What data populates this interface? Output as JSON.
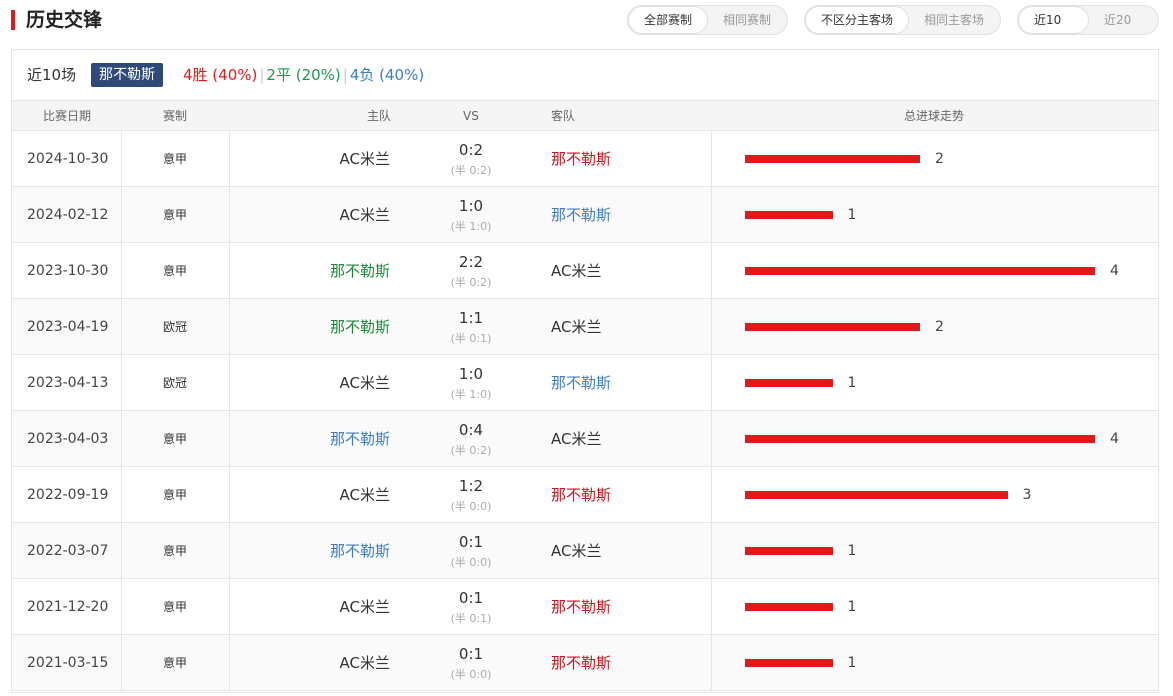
{
  "header": {
    "title": "历史交锋",
    "filters": [
      {
        "options": [
          "全部赛制",
          "相同赛制"
        ],
        "active": 0
      },
      {
        "options": [
          "不区分主客场",
          "相同主客场"
        ],
        "active": 0
      },
      {
        "options": [
          "近10场",
          "近20场"
        ],
        "active": 0
      }
    ]
  },
  "summary": {
    "label": "近10场",
    "team": "那不勒斯",
    "wins": "4胜 (40%)",
    "draws": "2平 (20%)",
    "losses": "4负 (40%)"
  },
  "table": {
    "columns": [
      "比赛日期",
      "赛制",
      "主队",
      "VS",
      "客队",
      "总进球走势"
    ],
    "rows": [
      {
        "date": "2024-10-30",
        "comp": "意甲",
        "home": "AC米兰",
        "home_color": "dark",
        "score": "0:2",
        "half": "(半 0:2)",
        "away": "那不勒斯",
        "away_color": "red",
        "total": 2
      },
      {
        "date": "2024-02-12",
        "comp": "意甲",
        "home": "AC米兰",
        "home_color": "dark",
        "score": "1:0",
        "half": "(半 1:0)",
        "away": "那不勒斯",
        "away_color": "blue",
        "total": 1
      },
      {
        "date": "2023-10-30",
        "comp": "意甲",
        "home": "那不勒斯",
        "home_color": "green",
        "score": "2:2",
        "half": "(半 0:2)",
        "away": "AC米兰",
        "away_color": "dark",
        "total": 4
      },
      {
        "date": "2023-04-19",
        "comp": "欧冠",
        "home": "那不勒斯",
        "home_color": "green",
        "score": "1:1",
        "half": "(半 0:1)",
        "away": "AC米兰",
        "away_color": "dark",
        "total": 2
      },
      {
        "date": "2023-04-13",
        "comp": "欧冠",
        "home": "AC米兰",
        "home_color": "dark",
        "score": "1:0",
        "half": "(半 1:0)",
        "away": "那不勒斯",
        "away_color": "blue",
        "total": 1
      },
      {
        "date": "2023-04-03",
        "comp": "意甲",
        "home": "那不勒斯",
        "home_color": "blue",
        "score": "0:4",
        "half": "(半 0:2)",
        "away": "AC米兰",
        "away_color": "dark",
        "total": 4
      },
      {
        "date": "2022-09-19",
        "comp": "意甲",
        "home": "AC米兰",
        "home_color": "dark",
        "score": "1:2",
        "half": "(半 0:0)",
        "away": "那不勒斯",
        "away_color": "red",
        "total": 3
      },
      {
        "date": "2022-03-07",
        "comp": "意甲",
        "home": "那不勒斯",
        "home_color": "blue",
        "score": "0:1",
        "half": "(半 0:0)",
        "away": "AC米兰",
        "away_color": "dark",
        "total": 1
      },
      {
        "date": "2021-12-20",
        "comp": "意甲",
        "home": "AC米兰",
        "home_color": "dark",
        "score": "0:1",
        "half": "(半 0:1)",
        "away": "那不勒斯",
        "away_color": "red",
        "total": 1
      },
      {
        "date": "2021-03-15",
        "comp": "意甲",
        "home": "AC米兰",
        "home_color": "dark",
        "score": "0:1",
        "half": "(半 0:0)",
        "away": "那不勒斯",
        "away_color": "red",
        "total": 1
      }
    ]
  },
  "colors": {
    "win": "#e01a1a",
    "draw": "#1a9a4a",
    "loss": "#3b7dc4",
    "badge": "#2d4a78",
    "bar": "#e01a1a"
  }
}
